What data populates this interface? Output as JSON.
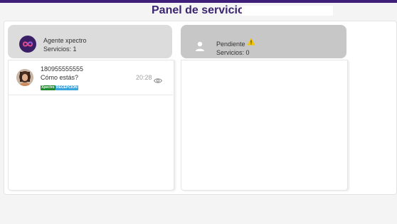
{
  "header": {
    "title": "Panel de servicio"
  },
  "columns": [
    {
      "name": "Agente xpectro",
      "services": "Servicios: 1",
      "avatar_icon": "infinity-logo-icon"
    },
    {
      "name": "Pendiente",
      "services": "Servicios: 0",
      "avatar_icon": "user-placeholder-icon",
      "status_icon": "warning-icon"
    }
  ],
  "conversations": [
    {
      "phone": "180955555555",
      "message": "Cómo estás?",
      "time": "20:28",
      "tags": [
        "Xpectro",
        "RECEPCION"
      ],
      "viewed_icon": "eye-icon"
    }
  ],
  "colors": {
    "accent": "#3f1f7a",
    "title": "#3b2470",
    "tag_green": "#1f8a2e",
    "tag_blue": "#3aa6dd",
    "warning": "#f2c500"
  }
}
